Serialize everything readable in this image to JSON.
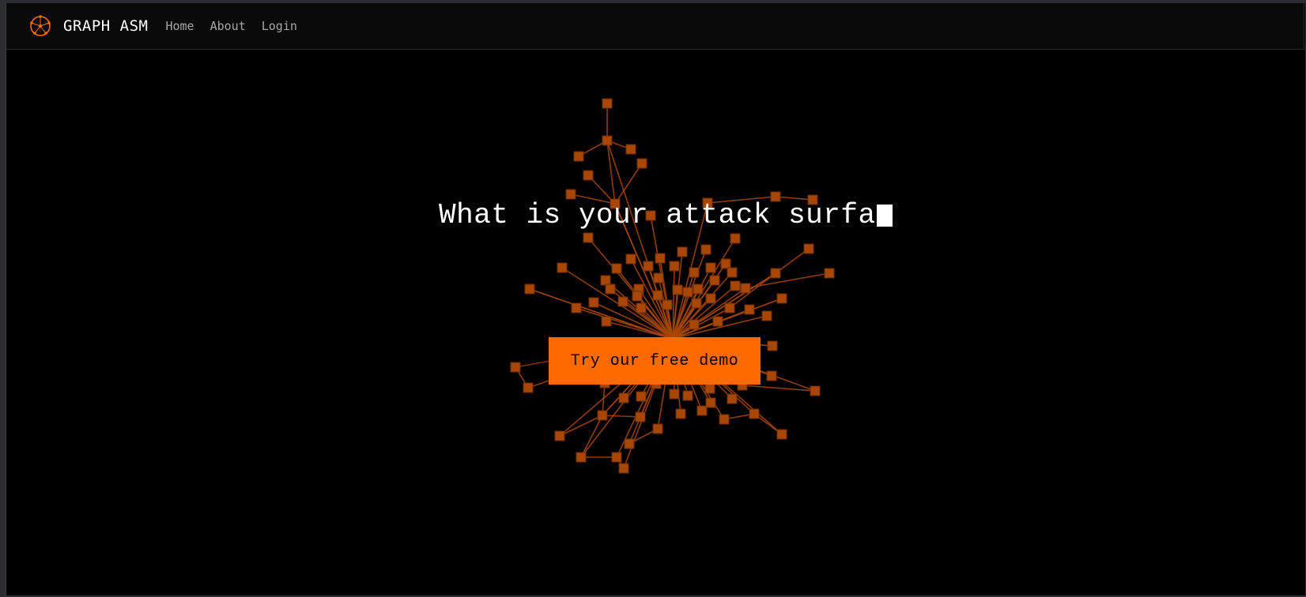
{
  "brand": {
    "name": "GRAPH ASM",
    "accent_color": "#ff6a00",
    "logo_icon": "network-graph-logo-icon"
  },
  "nav": {
    "items": [
      {
        "label": "Home"
      },
      {
        "label": "About"
      },
      {
        "label": "Login"
      }
    ]
  },
  "hero": {
    "title": "What is your attack surfa",
    "cta_label": "Try our free demo"
  },
  "graph": {
    "node_color": "#a84606",
    "edge_color": "#a84606"
  }
}
